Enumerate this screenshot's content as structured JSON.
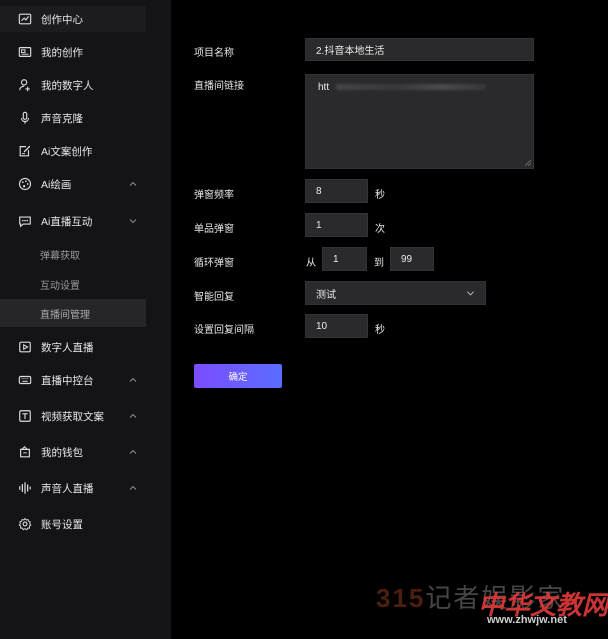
{
  "sidebar": {
    "items": [
      {
        "label": "创作中心",
        "icon": "chart-line-icon"
      },
      {
        "label": "我的创作",
        "icon": "image-frame-icon"
      },
      {
        "label": "我的数字人",
        "icon": "user-plus-icon"
      },
      {
        "label": "声音克隆",
        "icon": "microphone-icon"
      },
      {
        "label": "Ai文案创作",
        "icon": "edit-doc-icon"
      },
      {
        "label": "Ai绘画",
        "icon": "palette-icon"
      },
      {
        "label": "Ai直播互动",
        "icon": "chat-bubble-icon"
      },
      {
        "label": "数字人直播",
        "icon": "play-screen-icon"
      },
      {
        "label": "直播中控台",
        "icon": "keyboard-icon"
      },
      {
        "label": "视频获取文案",
        "icon": "text-box-icon"
      },
      {
        "label": "我的钱包",
        "icon": "wallet-icon"
      },
      {
        "label": "声音人直播",
        "icon": "sound-wave-icon"
      },
      {
        "label": "账号设置",
        "icon": "gear-icon"
      }
    ],
    "subitems": [
      {
        "label": "弹幕获取"
      },
      {
        "label": "互动设置"
      },
      {
        "label": "直播间管理"
      }
    ]
  },
  "form": {
    "project_name": {
      "label": "项目名称",
      "value": "2.抖音本地生活"
    },
    "live_link": {
      "label": "直播间链接",
      "value": "htt"
    },
    "danmaku_freq": {
      "label": "弹窗频率",
      "value": "8",
      "unit": "秒"
    },
    "single_popup": {
      "label": "单品弹窗",
      "value": "1",
      "unit": "次"
    },
    "loop_popup": {
      "label": "循环弹窗",
      "from_label": "从",
      "from_value": "1",
      "to_label": "到",
      "to_value": "99"
    },
    "smart_reply": {
      "label": "智能回复",
      "value": "测试"
    },
    "reply_interval": {
      "label": "设置回复间隔",
      "value": "10",
      "unit": "秒"
    },
    "confirm_label": "确定"
  },
  "watermark": {
    "brand_num": "315",
    "brand_text": "记者娱影家",
    "site_name": "中华文教网",
    "site_url": "www.zhwjw.net"
  },
  "colors": {
    "accent_start": "#7b4dff",
    "accent_end": "#5b6cff",
    "sidebar_bg": "#141416",
    "field_bg": "#2a2a2c"
  }
}
